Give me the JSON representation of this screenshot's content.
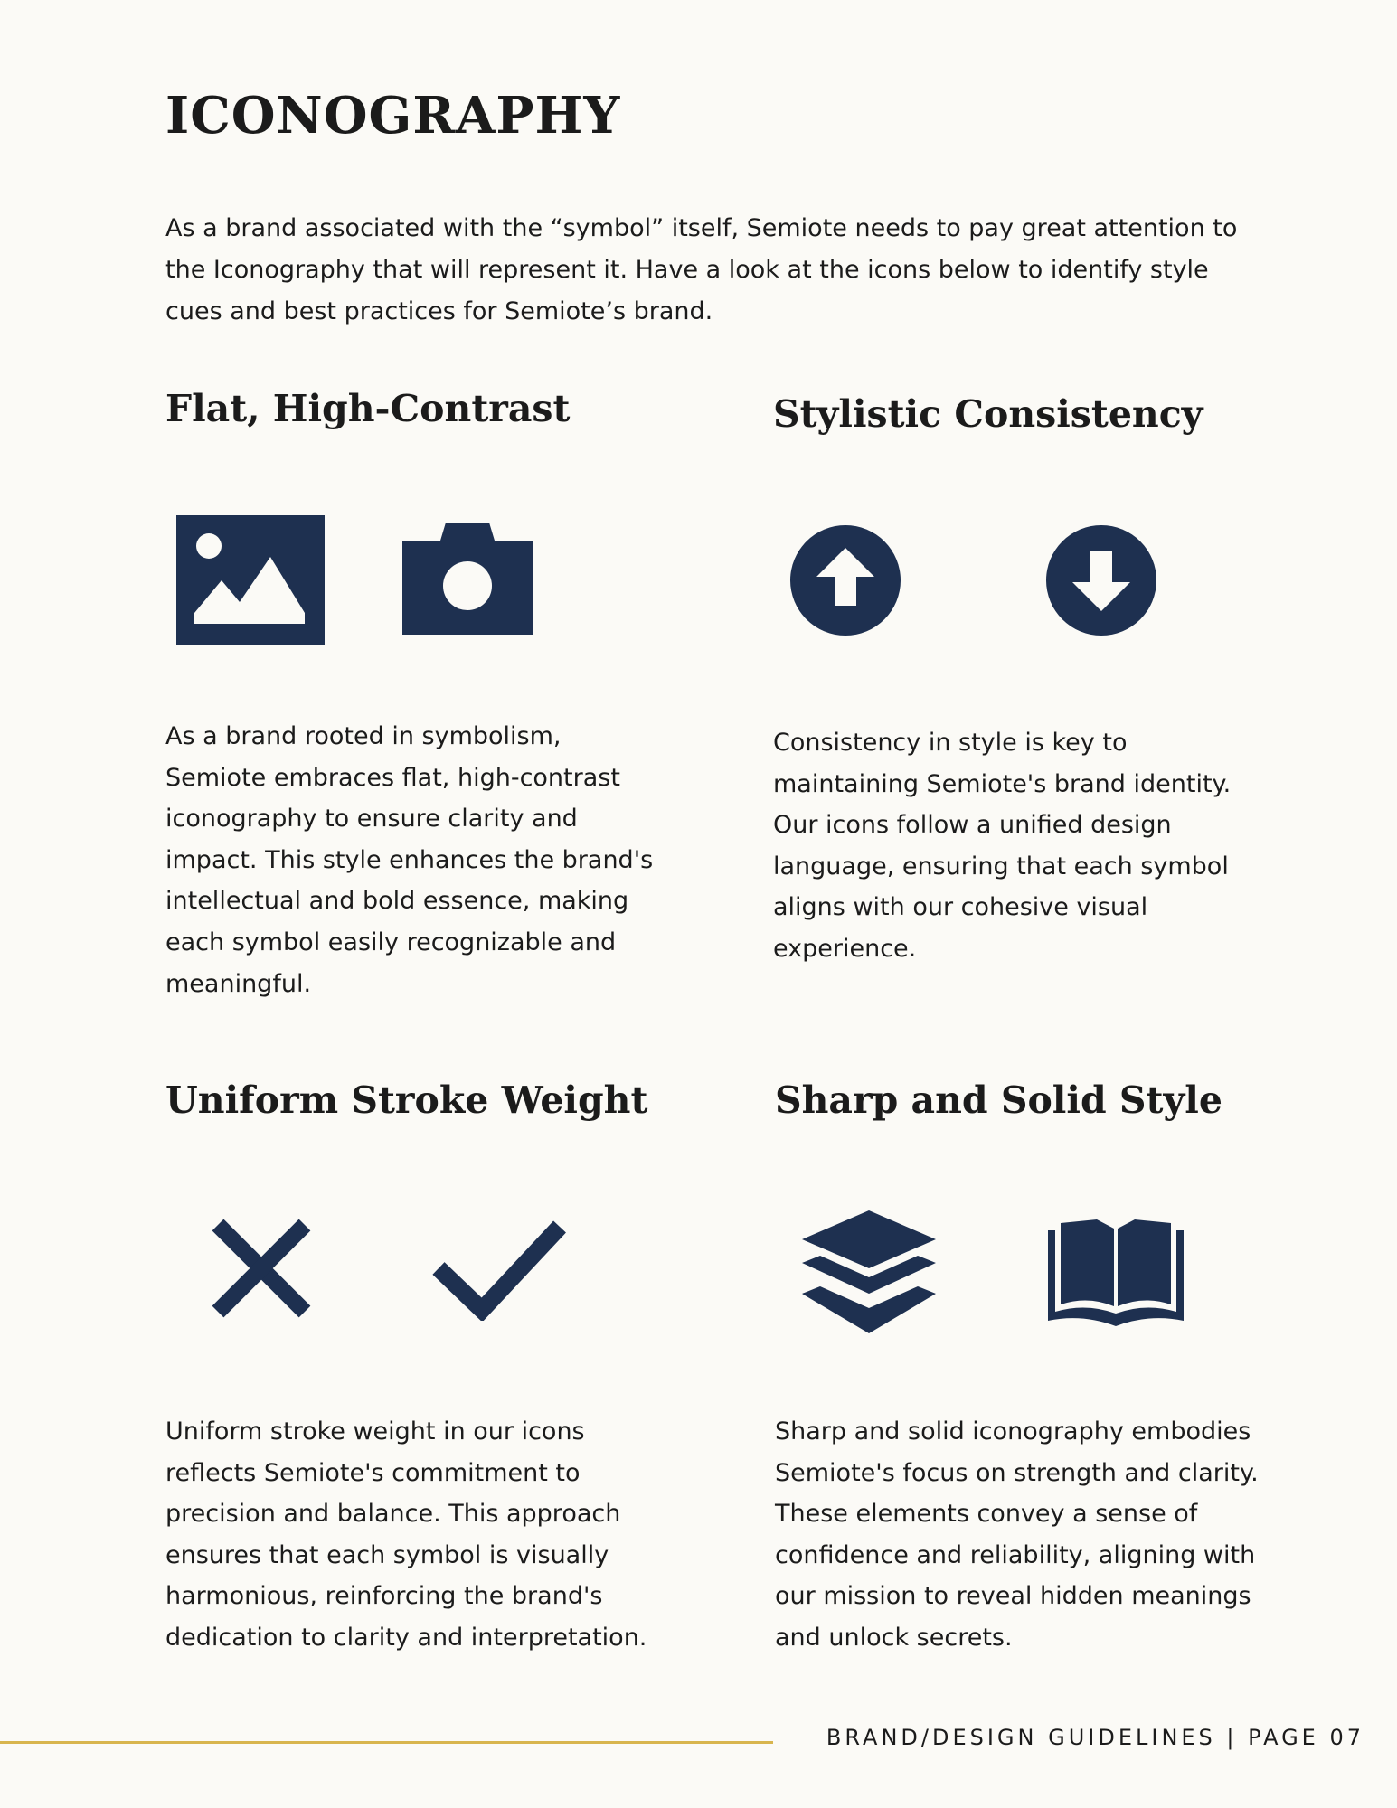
{
  "page": {
    "title": "ICONOGRAPHY",
    "intro": "As a brand associated with the “symbol” itself, Semiote needs to pay great attention to the Iconography that will represent it. Have a look at the icons below to identify style cues and best practices for Semiote’s brand."
  },
  "sections": [
    {
      "heading": "Flat, High-Contrast",
      "icons": [
        "image-icon",
        "camera-icon"
      ],
      "body": "As a brand rooted in symbolism, Semiote embraces flat, high-contrast iconography to ensure clarity and impact. This style enhances the brand's intellectual and bold essence, making each symbol easily recognizable and meaningful."
    },
    {
      "heading": "Stylistic Consistency",
      "icons": [
        "arrow-up-circle-icon",
        "arrow-down-circle-icon"
      ],
      "body": "Consistency in style is key to maintaining Semiote's brand identity. Our icons follow a unified design language, ensuring that each symbol aligns with our cohesive visual experience."
    },
    {
      "heading": "Uniform Stroke Weight",
      "icons": [
        "close-icon",
        "checkmark-icon"
      ],
      "body": "Uniform stroke weight in our icons reflects Semiote's commitment to precision and balance. This approach ensures that each symbol is visually harmonious, reinforcing the brand's dedication to clarity and interpretation."
    },
    {
      "heading": "Sharp and Solid Style",
      "icons": [
        "layers-icon",
        "book-icon"
      ],
      "body": "Sharp and solid iconography embodies Semiote's focus on strength and clarity. These elements convey a sense of confidence and reliability, aligning with our mission to reveal hidden meanings and unlock secrets."
    }
  ],
  "footer": {
    "text": "BRAND/DESIGN GUIDELINES | PAGE 07"
  },
  "colors": {
    "background": "#fbfaf6",
    "icon": "#1e3050",
    "accent_line": "#d8b54e",
    "text": "#1b1b1b"
  }
}
